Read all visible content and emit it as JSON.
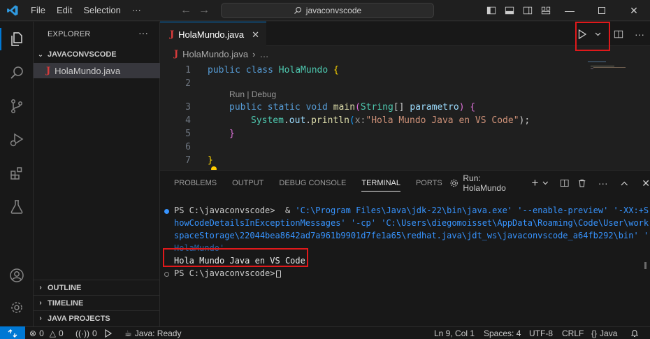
{
  "titlebar": {
    "menu": [
      "File",
      "Edit",
      "Selection",
      "···"
    ],
    "search": "javaconvscode"
  },
  "sidebar": {
    "title": "EXPLORER",
    "more": "···",
    "folder": "JAVACONVSCODE",
    "file": "HolaMundo.java",
    "sections": [
      "OUTLINE",
      "TIMELINE",
      "JAVA PROJECTS"
    ]
  },
  "editor": {
    "tab_label": "HolaMundo.java",
    "breadcrumb_file": "HolaMundo.java",
    "breadcrumb_rest": "…",
    "line_numbers": [
      "1",
      "2",
      "3",
      "4",
      "5",
      "6",
      "7"
    ],
    "codelens": "Run | Debug",
    "code": {
      "l1_kw": "public class ",
      "l1_cls": "HolaMundo",
      "l1_br": " {",
      "l3_kw": "public static void ",
      "l3_fn": "main",
      "l3_p1": "(",
      "l3_type": "String",
      "l3_arr": "[] ",
      "l3_param": "parametro",
      "l3_p2": ") ",
      "l3_br": "{",
      "l4_cls": "System",
      "l4_dot1": ".",
      "l4_out": "out",
      "l4_dot2": ".",
      "l4_fn": "println",
      "l4_p1": "(",
      "l4_hint": "x:",
      "l4_str": "\"Hola Mundo Java en VS Code\"",
      "l4_p2": ");",
      "l5_br": "}",
      "l7_br": "}"
    }
  },
  "panel": {
    "tabs": [
      "PROBLEMS",
      "OUTPUT",
      "DEBUG CONSOLE",
      "TERMINAL",
      "PORTS"
    ],
    "run_label": "Run: HolaMundo",
    "terminal": {
      "prompt1": "PS C:\\javaconvscode> ",
      "cmd_amp": " & ",
      "cmd1": "'C:\\Program Files\\Java\\jdk-22\\bin\\java.exe' '--enable-preview' '-XX:+S",
      "cmd2": "howCodeDetailsInExceptionMessages' '-cp' 'C:\\Users\\diegomoisset\\AppData\\Roaming\\Code\\User\\work",
      "cmd3": "spaceStorage\\22044bea8642ad7a961b9901d7fe1a65\\redhat.java\\jdt_ws\\javaconvscode_a64fb292\\bin' '",
      "cmd4": "HolaMundo'",
      "output": "Hola Mundo Java en VS Code",
      "prompt2": "PS C:\\javaconvscode>"
    }
  },
  "statusbar": {
    "errors": "0",
    "warnings": "0",
    "ports": "0",
    "java": "Java: Ready",
    "position": "Ln 9, Col 1",
    "spaces": "Spaces: 4",
    "encoding": "UTF-8",
    "eol": "CRLF",
    "language": "Java"
  },
  "colors": {
    "accent": "#0078d4",
    "highlight_box": "#e0191b",
    "java_icon": "#d83b3b"
  }
}
